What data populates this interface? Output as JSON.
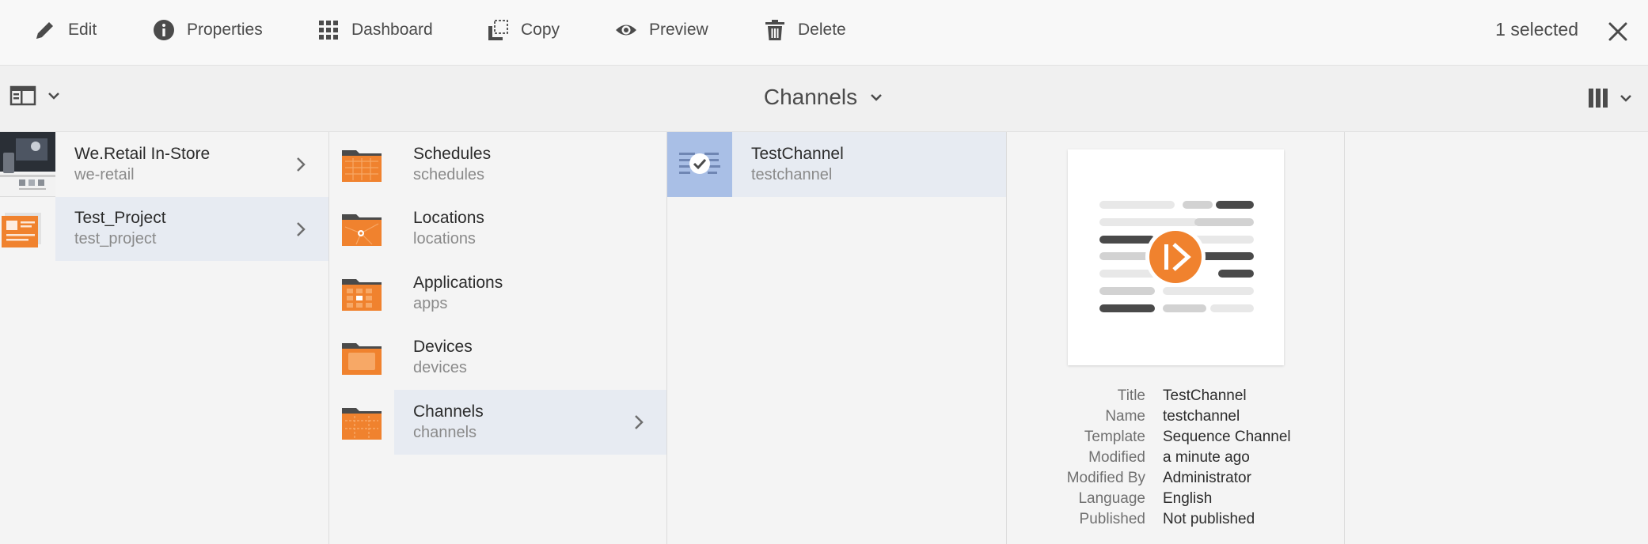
{
  "actionbar": {
    "actions": [
      {
        "label": "Edit",
        "icon": "pencil-icon"
      },
      {
        "label": "Properties",
        "icon": "info-icon"
      },
      {
        "label": "Dashboard",
        "icon": "grid-icon"
      },
      {
        "label": "Copy",
        "icon": "copy-icon"
      },
      {
        "label": "Preview",
        "icon": "eye-icon"
      },
      {
        "label": "Delete",
        "icon": "trash-icon"
      }
    ],
    "selection_label": "1 selected"
  },
  "titlebar": {
    "title": "Channels"
  },
  "columns": {
    "projects": [
      {
        "title": "We.Retail In-Store",
        "name": "we-retail",
        "active": false
      },
      {
        "title": "Test_Project",
        "name": "test_project",
        "active": true
      }
    ],
    "folders": [
      {
        "title": "Schedules",
        "name": "schedules",
        "active": false
      },
      {
        "title": "Locations",
        "name": "locations",
        "active": false
      },
      {
        "title": "Applications",
        "name": "apps",
        "active": false
      },
      {
        "title": "Devices",
        "name": "devices",
        "active": false
      },
      {
        "title": "Channels",
        "name": "channels",
        "active": true
      }
    ],
    "channels": [
      {
        "title": "TestChannel",
        "name": "testchannel",
        "selected": true
      }
    ]
  },
  "preview": {
    "properties": [
      {
        "key": "Title",
        "value": "TestChannel"
      },
      {
        "key": "Name",
        "value": "testchannel"
      },
      {
        "key": "Template",
        "value": "Sequence Channel"
      },
      {
        "key": "Modified",
        "value": "a minute ago"
      },
      {
        "key": "Modified By",
        "value": "Administrator"
      },
      {
        "key": "Language",
        "value": "English"
      },
      {
        "key": "Published",
        "value": "Not published"
      }
    ]
  },
  "colors": {
    "accent_orange": "#f0822e",
    "selection_blue": "#a9bfe6",
    "active_row": "#e7ebf2"
  }
}
